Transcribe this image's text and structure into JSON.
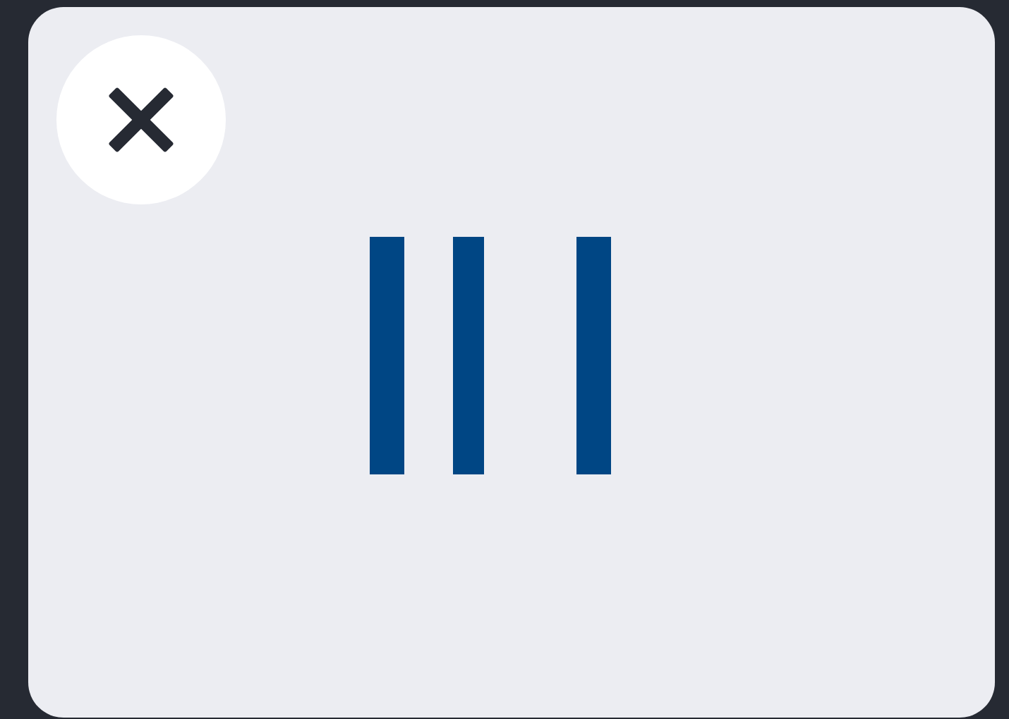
{
  "dialog": {
    "close_button": {
      "kind": "close"
    },
    "content": {
      "kind": "barcode"
    }
  }
}
